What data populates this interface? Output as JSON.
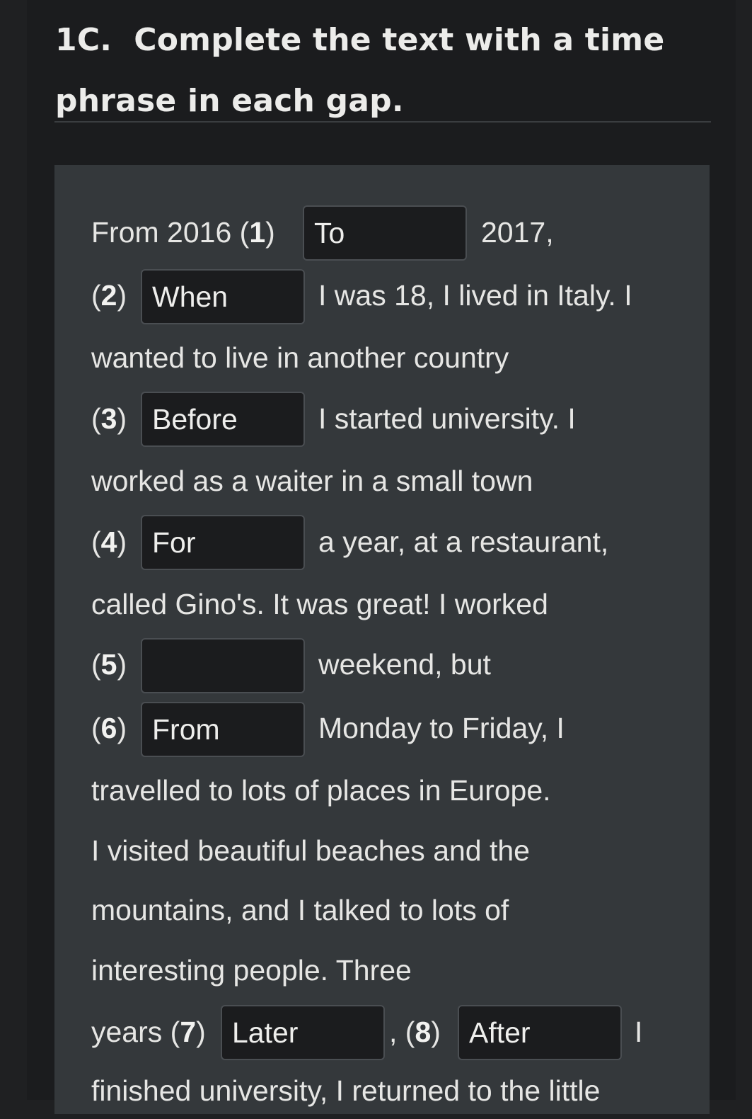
{
  "exercise": {
    "title_line1": "1C.  Complete the text with a time",
    "title_line2": "phrase in each gap."
  },
  "text": {
    "l1_pre": "From 2016 (",
    "l1_num": "1",
    "l1_post": ")",
    "l1_after": "2017,",
    "l2_num": "2",
    "l2_after": "I was 18, I lived in Italy. I",
    "l3": "wanted to live in another country",
    "l4_num": "3",
    "l4_after": "I started university. I",
    "l5": "worked as a waiter in a small town",
    "l6_num": "4",
    "l6_after": "a year, at a restaurant,",
    "l7": "called Gino's. It was great! I worked",
    "l8_num": "5",
    "l8_after": "weekend, but",
    "l9_num": "6",
    "l9_after": "Monday to Friday, I",
    "l10": "travelled to lots of places in Europe.",
    "l11": "I visited beautiful beaches and the",
    "l12": "mountains, and I talked to lots of",
    "l13": "interesting people. Three",
    "l14_pre": "years (",
    "l14_num7": "7",
    "l14_mid_pre": ", (",
    "l14_num8": "8",
    "l14_close": ")",
    "l14_after": "I",
    "l15": "finished university, I returned to the little"
  },
  "gaps": [
    {
      "id": 1,
      "value": "To"
    },
    {
      "id": 2,
      "value": "When"
    },
    {
      "id": 3,
      "value": "Before"
    },
    {
      "id": 4,
      "value": "For"
    },
    {
      "id": 5,
      "value": ""
    },
    {
      "id": 6,
      "value": "From"
    },
    {
      "id": 7,
      "value": "Later"
    },
    {
      "id": 8,
      "value": "After"
    }
  ]
}
